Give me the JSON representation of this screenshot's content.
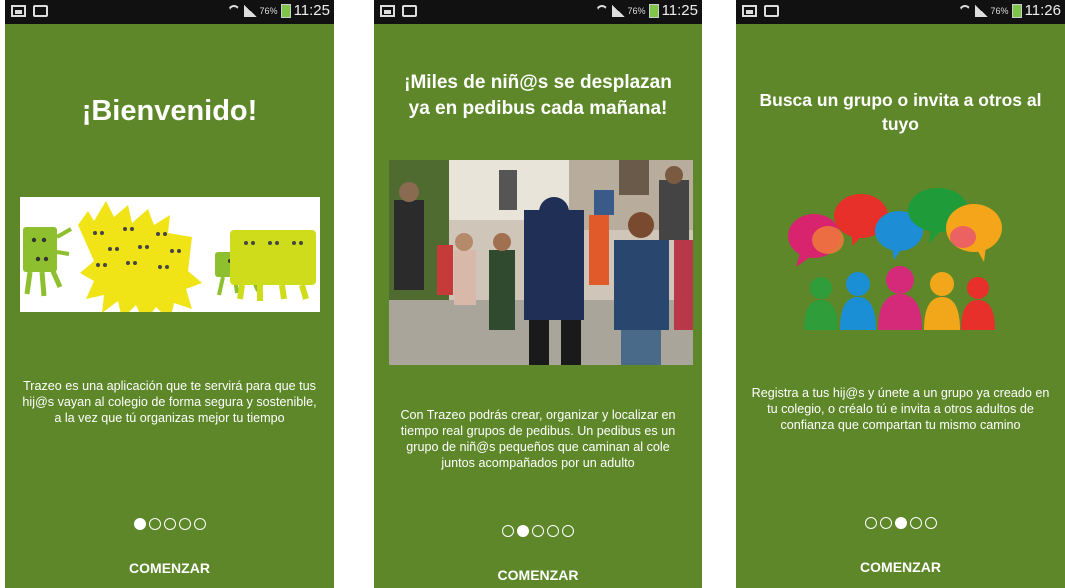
{
  "status_bar": {
    "battery": "76%",
    "times": [
      "11:25",
      "11:25",
      "11:26"
    ]
  },
  "screens": [
    {
      "title": "¡Bienvenido!",
      "description": "Trazeo es una aplicación que te servirá para que tus hij@s vayan al colegio de forma segura y sostenible, a la vez que tú organizas mejor tu tiempo",
      "active_page": 1,
      "button": "COMENZAR",
      "image": "monster-characters-illustration"
    },
    {
      "title": "¡Miles de niñ@s se desplazan ya en pedibus cada mañana!",
      "description": "Con Trazeo podrás crear, organizar y localizar en tiempo real grupos de pedibus. Un pedibus es un grupo de niñ@s pequeños que caminan al cole juntos acompañados por un adulto",
      "active_page": 2,
      "button": "COMENZAR",
      "image": "children-walking-photo"
    },
    {
      "title": "Busca un grupo o invita a otros al tuyo",
      "description": "Registra a tus hij@s y únete a un grupo ya creado en tu colegio, o créalo tú e invita a otros adultos de confianza que compartan tu mismo camino",
      "active_page": 3,
      "button": "COMENZAR",
      "image": "speech-bubbles-people-illustration"
    }
  ],
  "colors": {
    "background": "#5d8729",
    "status_bar": "#111111",
    "text": "#ffffff"
  }
}
